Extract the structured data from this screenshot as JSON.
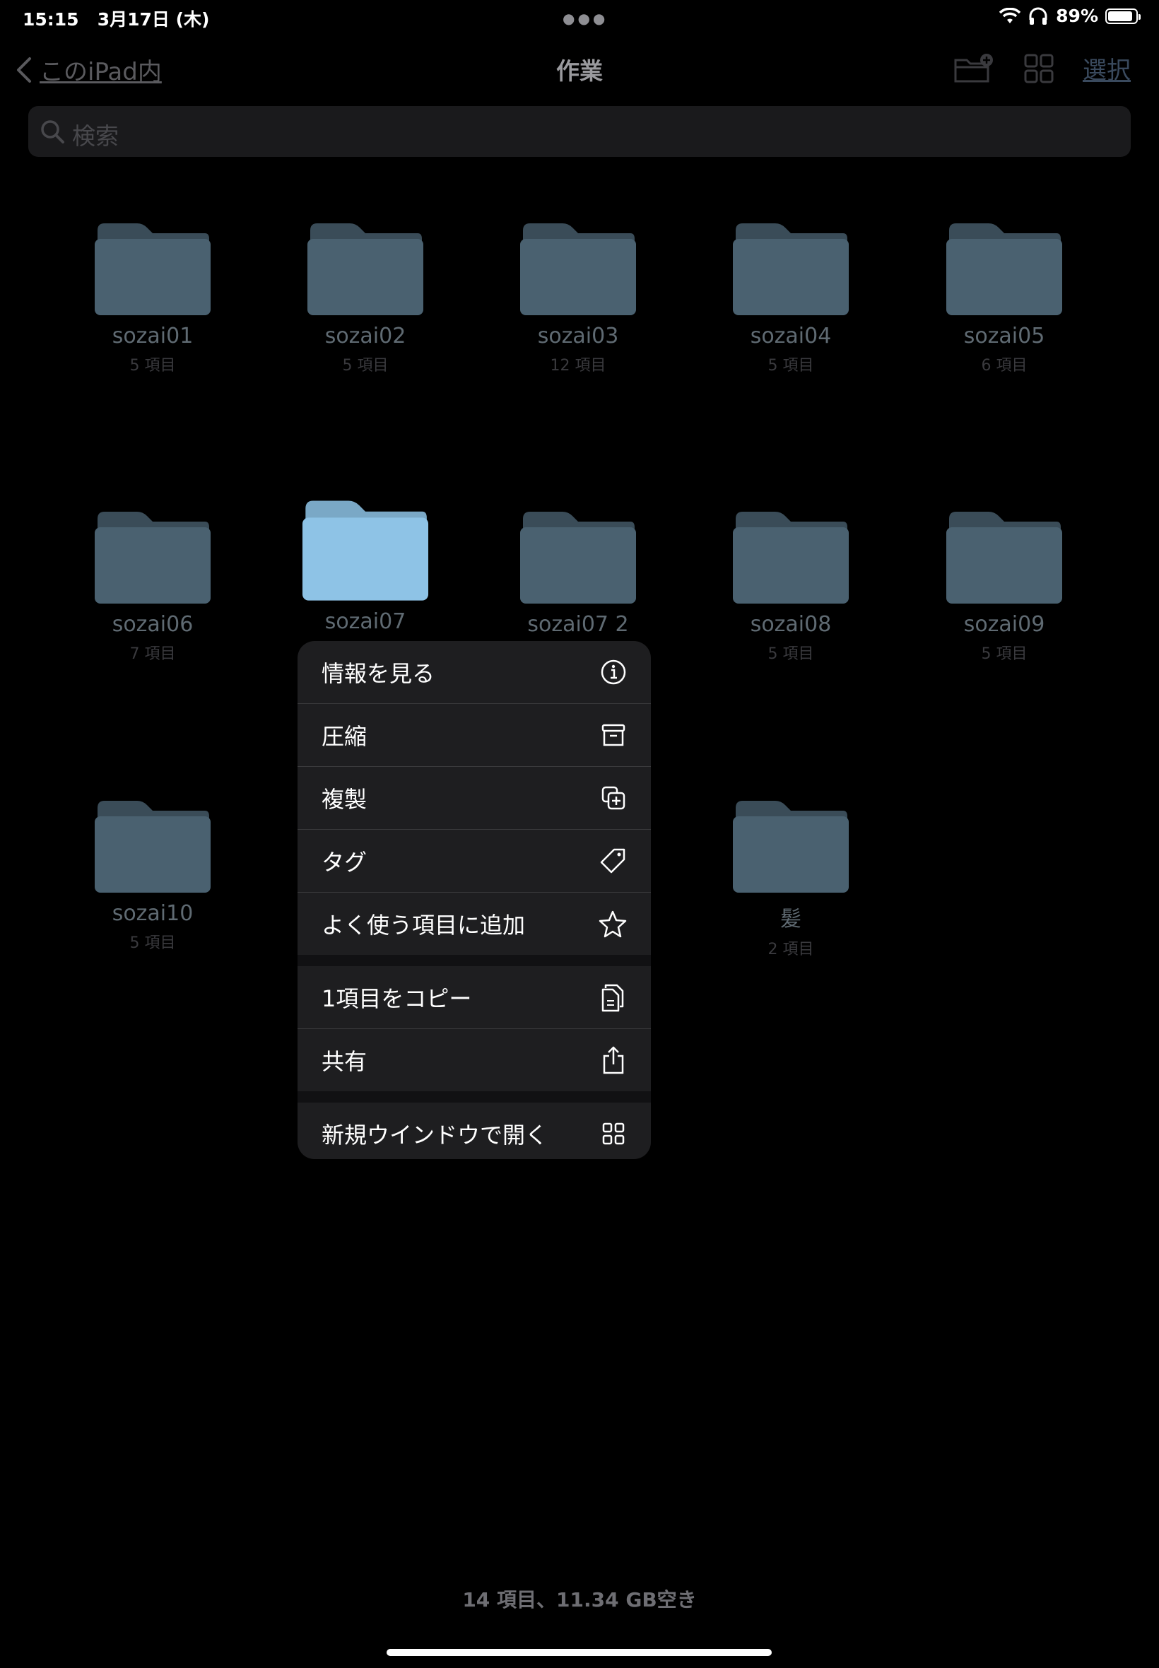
{
  "status": {
    "time": "15:15",
    "date": "3月17日 (木)",
    "battery_percent": "89%",
    "battery_level": 0.89
  },
  "nav": {
    "back_label": "このiPad内",
    "title": "作業",
    "select_label": "選択"
  },
  "search": {
    "placeholder": "検索"
  },
  "folders": [
    {
      "name": "sozai01",
      "count": "5 項目"
    },
    {
      "name": "sozai02",
      "count": "5 項目"
    },
    {
      "name": "sozai03",
      "count": "12 項目"
    },
    {
      "name": "sozai04",
      "count": "5 項目"
    },
    {
      "name": "sozai05",
      "count": "6 項目"
    },
    {
      "name": "sozai06",
      "count": "7 項目"
    },
    {
      "name": "sozai07",
      "count": ""
    },
    {
      "name": "sozai07 2",
      "count": ""
    },
    {
      "name": "sozai08",
      "count": "5 項目"
    },
    {
      "name": "sozai09",
      "count": "5 項目"
    },
    {
      "name": "sozai10",
      "count": "5 項目"
    },
    {
      "name": "髪",
      "count": "2 項目"
    }
  ],
  "menu": {
    "items": [
      {
        "label": "情報を見る",
        "icon": "info-icon"
      },
      {
        "label": "圧縮",
        "icon": "archive-icon"
      },
      {
        "label": "複製",
        "icon": "duplicate-icon"
      },
      {
        "label": "タグ",
        "icon": "tag-icon"
      },
      {
        "label": "よく使う項目に追加",
        "icon": "star-icon"
      },
      {
        "label": "1項目をコピー",
        "icon": "copy-icon"
      },
      {
        "label": "共有",
        "icon": "share-icon"
      },
      {
        "label": "新規ウインドウで開く",
        "icon": "new-window-icon"
      }
    ]
  },
  "footer": {
    "summary": "14 項目、11.34 GB空き"
  },
  "colors": {
    "background": "#000000",
    "folder_dim": "#4a6170",
    "folder_selected": "#8ec3e6",
    "menu_bg": "#1e1e20"
  }
}
